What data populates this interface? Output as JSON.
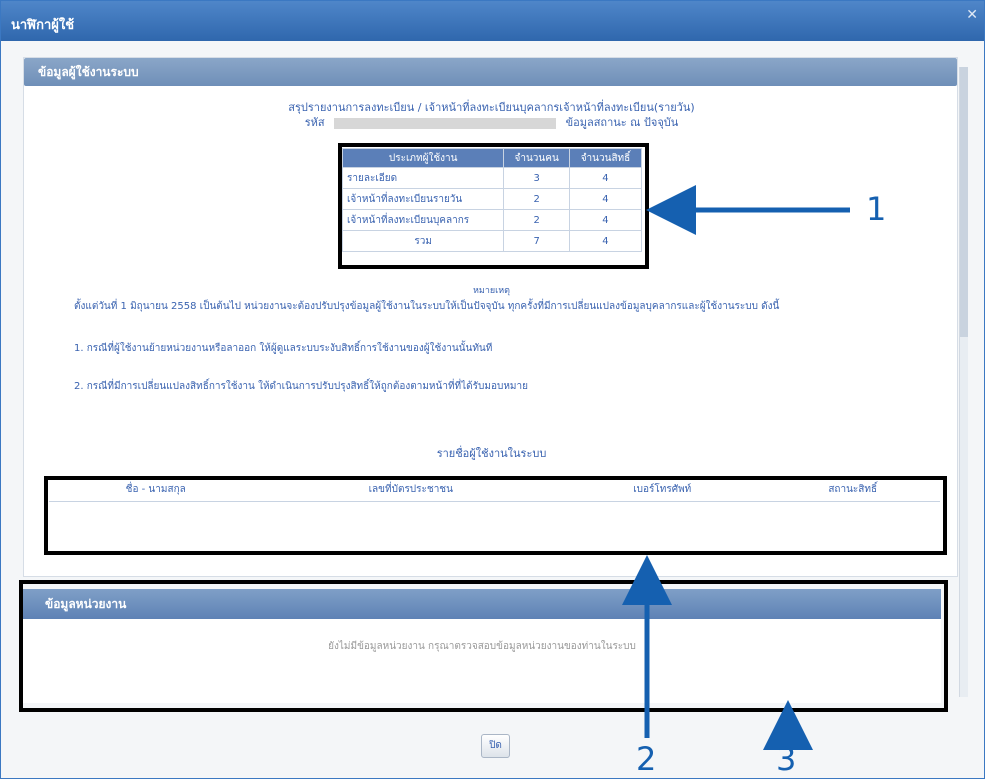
{
  "window": {
    "title": "นาฬิกาผู้ใช้"
  },
  "panel": {
    "header": "ข้อมูลผู้ใช้งานระบบ",
    "report_line1": "สรุปรายงานการลงทะเบียน / เจ้าหน้าที่ลงทะเบียนบุคลากรเจ้าหน้าที่ลงทะเบียน(รายวัน)",
    "report_line2_left": "รหัส",
    "report_line2_right": "ข้อมูลสถานะ ณ ปัจจุบัน",
    "table": {
      "headers": [
        "ประเภทผู้ใช้งาน",
        "จำนวนคน",
        "จำนวนสิทธิ์"
      ],
      "rows": [
        [
          "รายละเอียด",
          "3",
          "4"
        ],
        [
          "เจ้าหน้าที่ลงทะเบียนรายวัน",
          "2",
          "4"
        ],
        [
          "เจ้าหน้าที่ลงทะเบียนบุคลากร",
          "2",
          "4"
        ],
        [
          "รวม",
          "7",
          "4"
        ]
      ]
    },
    "notes_label": "หมายเหตุ",
    "note_1": "ตั้งแต่วันที่ 1 มิถุนายน 2558 เป็นต้นไป หน่วยงานจะต้องปรับปรุงข้อมูลผู้ใช้งานในระบบให้เป็นปัจจุบัน ทุกครั้งที่มีการเปลี่ยนแปลงข้อมูลบุคลากรและผู้ใช้งานระบบ ดังนี้",
    "note_2": "1. กรณีที่ผู้ใช้งานย้ายหน่วยงานหรือลาออก ให้ผู้ดูแลระบบระงับสิทธิ์การใช้งานของผู้ใช้งานนั้นทันที",
    "note_3": "2. กรณีที่มีการเปลี่ยนแปลงสิทธิ์การใช้งาน ให้ดำเนินการปรับปรุงสิทธิ์ให้ถูกต้องตามหน้าที่ที่ได้รับมอบหมาย",
    "list_caption": "รายชื่อผู้ใช้งานในระบบ"
  },
  "user_table": {
    "headers": [
      "ชื่อ - นามสกุล",
      "เลขที่บัตรประชาชน",
      "เบอร์โทรศัพท์",
      "สถานะสิทธิ์"
    ]
  },
  "section2": {
    "header": "ข้อมูลหน่วยงาน",
    "message": "ยังไม่มีข้อมูลหน่วยงาน กรุณาตรวจสอบข้อมูลหน่วยงานของท่านในระบบ"
  },
  "ok_button": "ปิด",
  "annotations": {
    "label_1": "1",
    "label_2": "2",
    "label_3": "3"
  }
}
